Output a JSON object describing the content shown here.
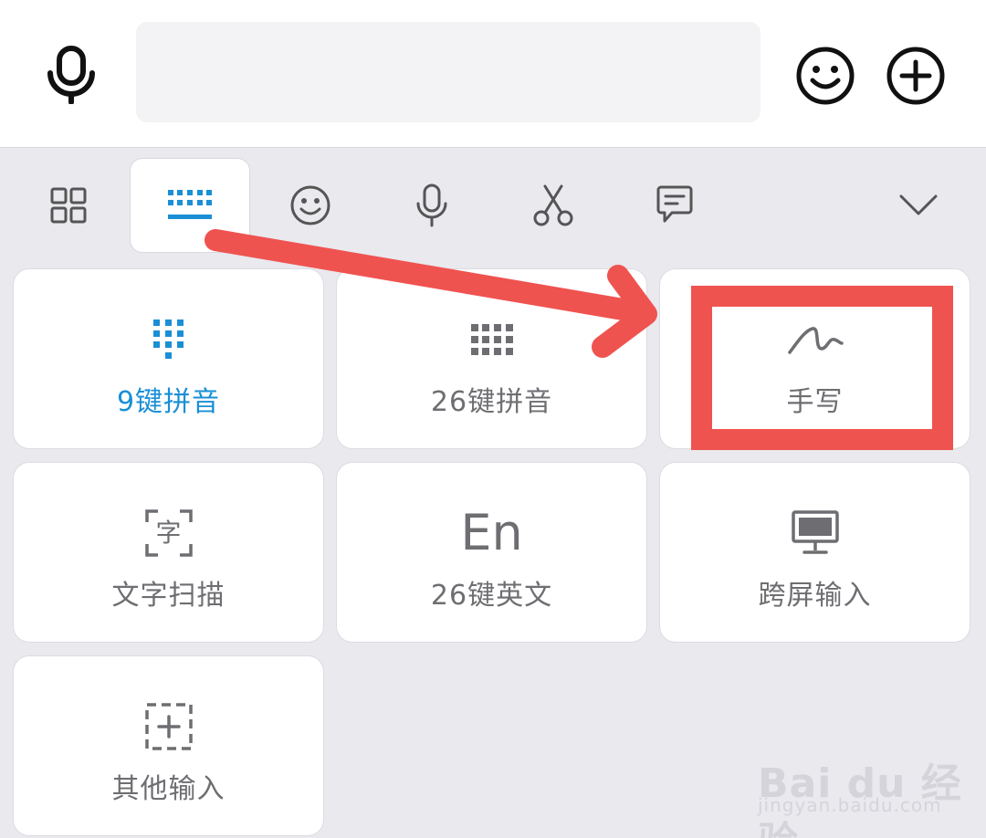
{
  "input_bar": {
    "mic_icon": "microphone-icon",
    "placeholder": "",
    "emoji_icon": "smiley-icon",
    "add_icon": "plus-circle-icon"
  },
  "toolbar": {
    "items": [
      {
        "icon": "grid-apps-icon",
        "active": false
      },
      {
        "icon": "keyboard-icon",
        "active": true
      },
      {
        "icon": "smiley-icon",
        "active": false
      },
      {
        "icon": "microphone-icon",
        "active": false
      },
      {
        "icon": "scissors-icon",
        "active": false
      },
      {
        "icon": "speech-bubble-icon",
        "active": false
      },
      {
        "icon": "chevron-down-icon",
        "active": false
      }
    ],
    "accent_color": "#1a8fd6"
  },
  "layouts": [
    {
      "label": "9键拼音",
      "icon": "nine-key-keypad-icon",
      "selected": true
    },
    {
      "label": "26键拼音",
      "icon": "full-keyboard-icon",
      "selected": false
    },
    {
      "label": "手写",
      "icon": "handwriting-scribble-icon",
      "selected": false
    },
    {
      "label": "文字扫描",
      "icon": "text-scan-icon",
      "glyph": "字",
      "selected": false
    },
    {
      "label": "26键英文",
      "icon": "english-letters-icon",
      "glyph": "En",
      "selected": false
    },
    {
      "label": "跨屏输入",
      "icon": "monitor-icon",
      "selected": false
    },
    {
      "label": "其他输入",
      "icon": "dashed-plus-icon",
      "selected": false
    }
  ],
  "annotation": {
    "color": "#ef5350",
    "target": "手写"
  },
  "watermark": {
    "brand": "Bai du 经验",
    "url": "jingyan.baidu.com"
  }
}
